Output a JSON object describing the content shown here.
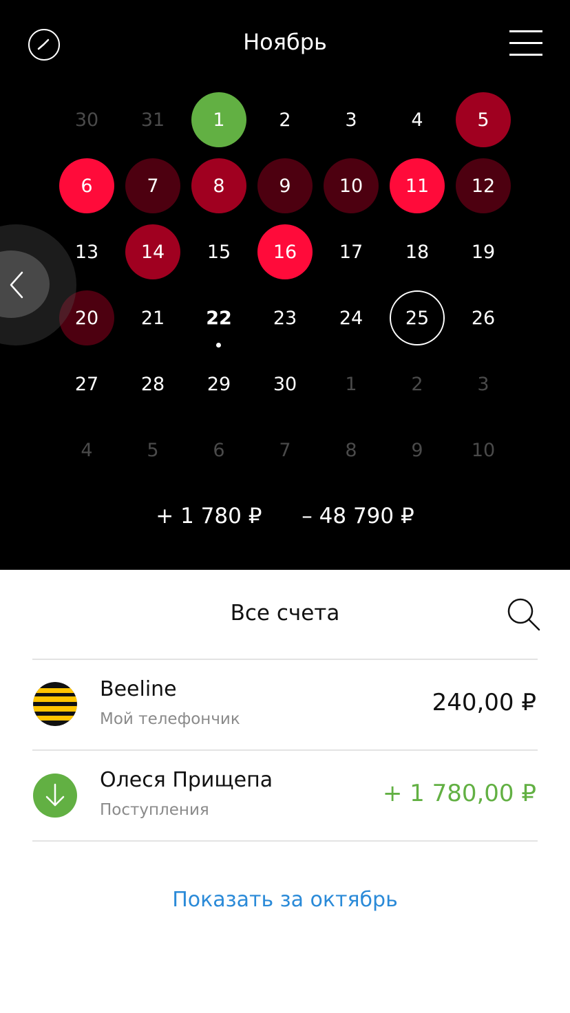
{
  "header": {
    "title": "Ноябрь"
  },
  "calendar": {
    "rows": [
      [
        {
          "label": "30",
          "muted": true
        },
        {
          "label": "31",
          "muted": true
        },
        {
          "label": "1",
          "color": "#62b043"
        },
        {
          "label": "2"
        },
        {
          "label": "3"
        },
        {
          "label": "4"
        },
        {
          "label": "5",
          "color": "#a00020"
        }
      ],
      [
        {
          "label": "6",
          "color": "#ff0b3a"
        },
        {
          "label": "7",
          "color": "#4d0010"
        },
        {
          "label": "8",
          "color": "#a00020"
        },
        {
          "label": "9",
          "color": "#4d0010"
        },
        {
          "label": "10",
          "color": "#4d0010"
        },
        {
          "label": "11",
          "color": "#ff0b3a"
        },
        {
          "label": "12",
          "color": "#4d0010"
        }
      ],
      [
        {
          "label": "13"
        },
        {
          "label": "14",
          "color": "#a00020"
        },
        {
          "label": "15"
        },
        {
          "label": "16",
          "color": "#ff0b3a"
        },
        {
          "label": "17"
        },
        {
          "label": "18"
        },
        {
          "label": "19"
        }
      ],
      [
        {
          "label": "20",
          "color": "#4d0010"
        },
        {
          "label": "21"
        },
        {
          "label": "22",
          "today": true
        },
        {
          "label": "23"
        },
        {
          "label": "24"
        },
        {
          "label": "25",
          "outlined": true
        },
        {
          "label": "26"
        }
      ],
      [
        {
          "label": "27"
        },
        {
          "label": "28"
        },
        {
          "label": "29"
        },
        {
          "label": "30"
        },
        {
          "label": "1",
          "muted": true
        },
        {
          "label": "2",
          "muted": true
        },
        {
          "label": "3",
          "muted": true
        }
      ],
      [
        {
          "label": "4",
          "muted": true
        },
        {
          "label": "5",
          "muted": true
        },
        {
          "label": "6",
          "muted": true
        },
        {
          "label": "7",
          "muted": true
        },
        {
          "label": "8",
          "muted": true
        },
        {
          "label": "9",
          "muted": true
        },
        {
          "label": "10",
          "muted": true
        }
      ]
    ]
  },
  "totals": {
    "income": "+ 1 780 ₽",
    "expense": "– 48 790 ₽"
  },
  "list": {
    "title": "Все счета",
    "items": [
      {
        "name": "Beeline",
        "subtitle": "Мой телефончик",
        "amount": "240,00 ₽",
        "amount_color": "#111111",
        "icon": "beeline-logo-icon"
      },
      {
        "name": "Олеся Прищепа",
        "subtitle": "Поступления",
        "amount": "+ 1 780,00 ₽",
        "amount_color": "#62b043",
        "icon": "arrow-down-icon"
      }
    ]
  },
  "footer": {
    "show_link": "Показать за октябрь"
  },
  "colors": {
    "accent_link": "#2a8ad8",
    "income_green": "#62b043",
    "expense_red": "#ff0b3a"
  }
}
